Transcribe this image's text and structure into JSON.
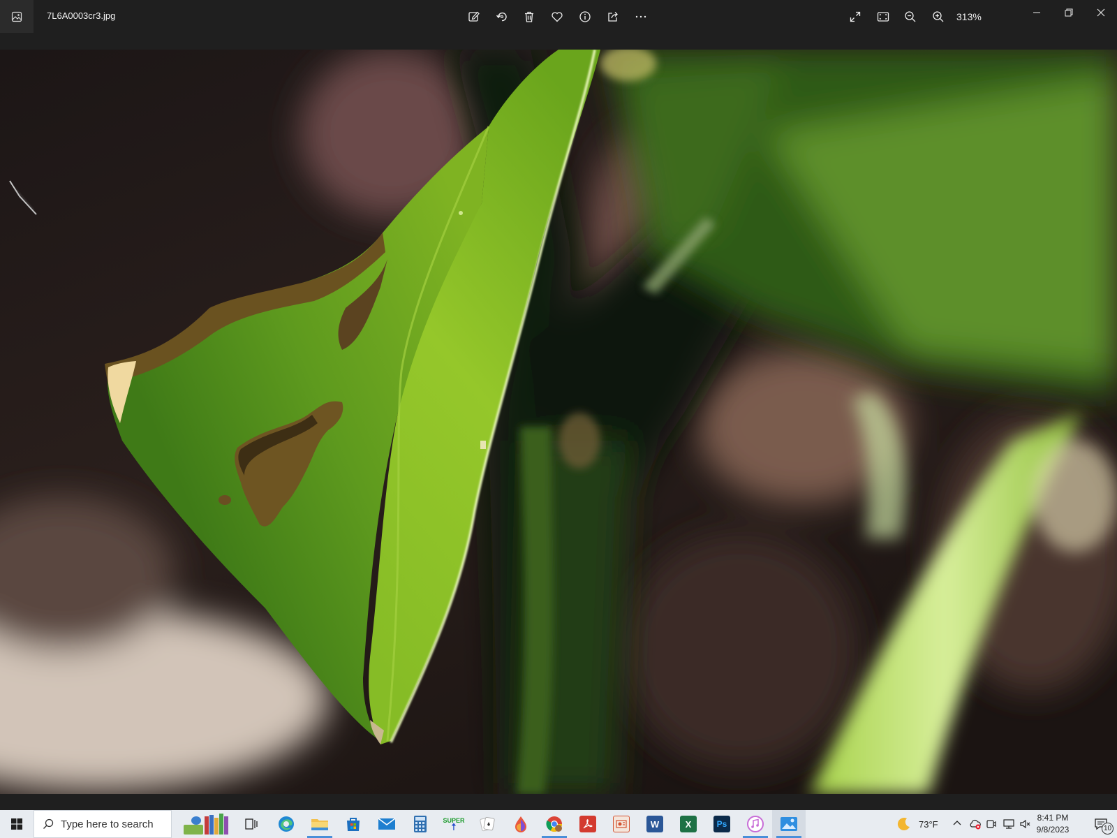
{
  "window": {
    "filename": "7L6A0003cr3.jpg",
    "zoom": "313%"
  },
  "toolbar": {
    "icons": [
      "edit-image-icon",
      "rotate-icon",
      "delete-icon",
      "favorite-icon",
      "info-icon",
      "share-icon",
      "more-icon"
    ],
    "view_icons": [
      "full-screen-icon",
      "actual-size-icon",
      "zoom-out-icon",
      "zoom-in-icon"
    ]
  },
  "taskbar": {
    "search_placeholder": "Type here to search",
    "apps": [
      "books-icon",
      "task-view-icon",
      "edge-icon",
      "file-explorer-icon",
      "store-icon",
      "mail-icon",
      "calculator-icon",
      "super-icon",
      "solitaire-icon",
      "paint-icon",
      "chrome-icon",
      "acrobat-icon",
      "powerpoint-icon",
      "word-icon",
      "excel-icon",
      "photoshop-icon",
      "itunes-icon",
      "photos-icon"
    ],
    "super_label": "SUPER",
    "word_label": "W",
    "excel_label": "X",
    "ps_label": "Ps",
    "weather": "73°F",
    "time": "8:41 PM",
    "date": "9/8/2023",
    "notification_count": "10"
  },
  "colors": {
    "titlebar": "#1f1f1f",
    "taskbar": "#e8ecf1",
    "accent": "#4a8fd9",
    "leaf_bright": "#8dbf24",
    "leaf_dark": "#4f8a1a"
  }
}
